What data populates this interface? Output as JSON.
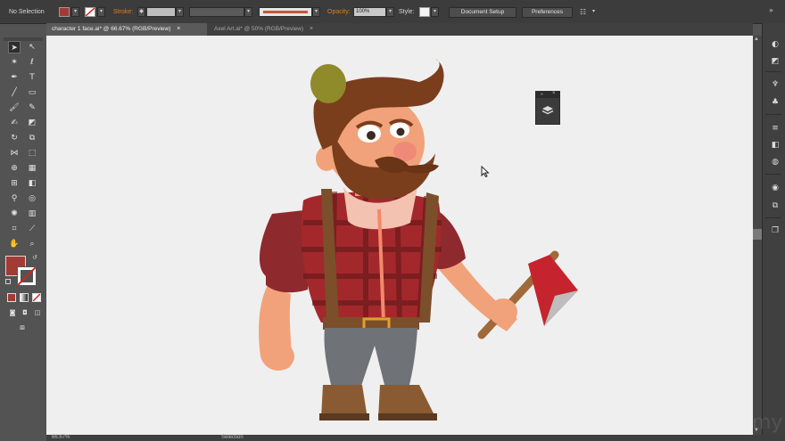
{
  "control_bar": {
    "selection_status": "No Selection",
    "stroke_label": "Stroke:",
    "opacity_label": "Opacity:",
    "opacity_value": "100%",
    "style_label": "Style:",
    "document_setup_label": "Document Setup",
    "preferences_label": "Preferences",
    "fill_color": "#a33b35"
  },
  "tabs": [
    {
      "label": "character 1 face.ai* @ 66.67% (RGB/Preview)",
      "close": "×"
    },
    {
      "label": "Axel Art.ai* @ 50% (RGB/Preview)",
      "close": "×"
    }
  ],
  "status_bar": {
    "zoom": "66.67%",
    "tool_name": "Selection"
  },
  "watermark": "my",
  "icons": {
    "tools": [
      "selection-tool-icon",
      "direct-selection-tool-icon",
      "magic-wand-tool-icon",
      "lasso-tool-icon",
      "pen-tool-icon",
      "type-tool-icon",
      "line-tool-icon",
      "rectangle-tool-icon",
      "paintbrush-tool-icon",
      "pencil-tool-icon",
      "blob-brush-tool-icon",
      "eraser-tool-icon",
      "rotate-tool-icon",
      "scale-tool-icon",
      "width-tool-icon",
      "free-transform-tool-icon",
      "shape-builder-tool-icon",
      "perspective-grid-tool-icon",
      "mesh-tool-icon",
      "gradient-tool-icon",
      "eyedropper-tool-icon",
      "blend-tool-icon",
      "symbol-sprayer-tool-icon",
      "column-graph-tool-icon",
      "artboard-tool-icon",
      "slice-tool-icon",
      "hand-tool-icon",
      "zoom-tool-icon"
    ],
    "dock": [
      "color-panel-icon",
      "color-guide-icon",
      "brushes-icon",
      "symbols-icon",
      "stroke-icon",
      "gradient-icon",
      "transparency-icon",
      "appearance-icon",
      "graphic-styles-icon",
      "layers-icon"
    ]
  },
  "colors": {
    "fill_swatch": "#a33b35",
    "canvas": "#efefef",
    "orange_label": "#e07b24"
  }
}
